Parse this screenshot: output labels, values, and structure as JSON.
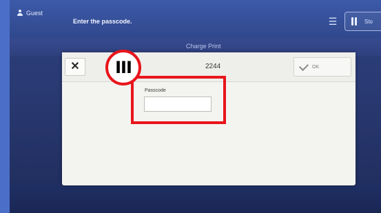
{
  "header": {
    "user_label": "Guest",
    "prompt": "Enter the passcode.",
    "stop_label": "Sto"
  },
  "subheader": {
    "title": "Charge Print"
  },
  "dialog": {
    "code": "2244",
    "ok_label": "OK",
    "passcode_label": "Passcode",
    "passcode_value": ""
  },
  "annotation": {
    "step": "III",
    "color": "#e8151b"
  },
  "icons": [
    "user-icon",
    "menu-icon",
    "pause-icon",
    "close-icon",
    "check-icon"
  ]
}
